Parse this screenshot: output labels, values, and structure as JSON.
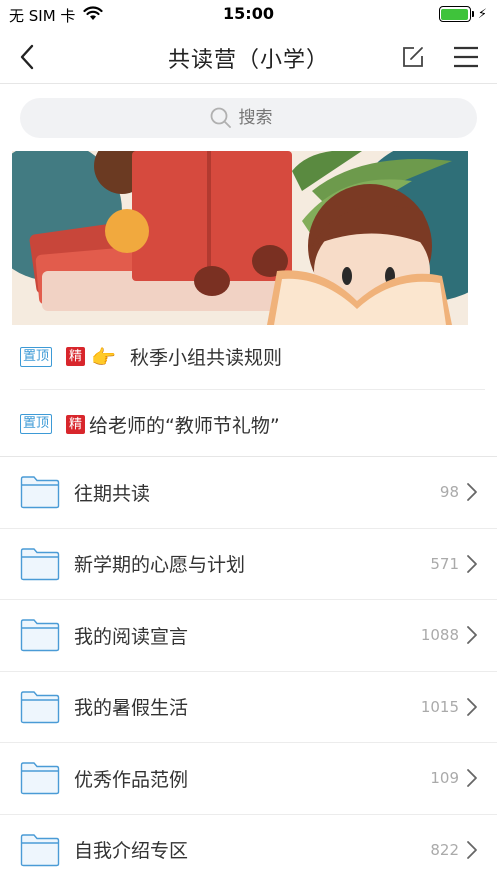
{
  "status_bar": {
    "carrier": "无 SIM 卡",
    "time": "15:00",
    "battery_level": 1.0,
    "battery_color": "#3fc33b"
  },
  "nav": {
    "title": "共读营（小学）",
    "back_icon": "chevron-left-icon",
    "edit_icon": "edit-icon",
    "menu_icon": "menu-icon"
  },
  "search": {
    "placeholder": "搜索"
  },
  "pinned": [
    {
      "top_tag": "置顶",
      "elite_tag": "精",
      "title": "秋季小组共读规则"
    },
    {
      "top_tag": "置顶",
      "elite_tag": "精",
      "title": "给老师的“教师节礼物”"
    }
  ],
  "folders": [
    {
      "name": "往期共读",
      "count": "98"
    },
    {
      "name": "新学期的心愿与计划",
      "count": "571"
    },
    {
      "name": "我的阅读宣言",
      "count": "1088"
    },
    {
      "name": "我的暑假生活",
      "count": "1015"
    },
    {
      "name": "优秀作品范例",
      "count": "109"
    },
    {
      "name": "自我介绍专区",
      "count": "822"
    }
  ],
  "colors": {
    "top_tag": "#3d9ad6",
    "elite_tag": "#d8262c",
    "folder_icon": "#3d9ad6"
  }
}
